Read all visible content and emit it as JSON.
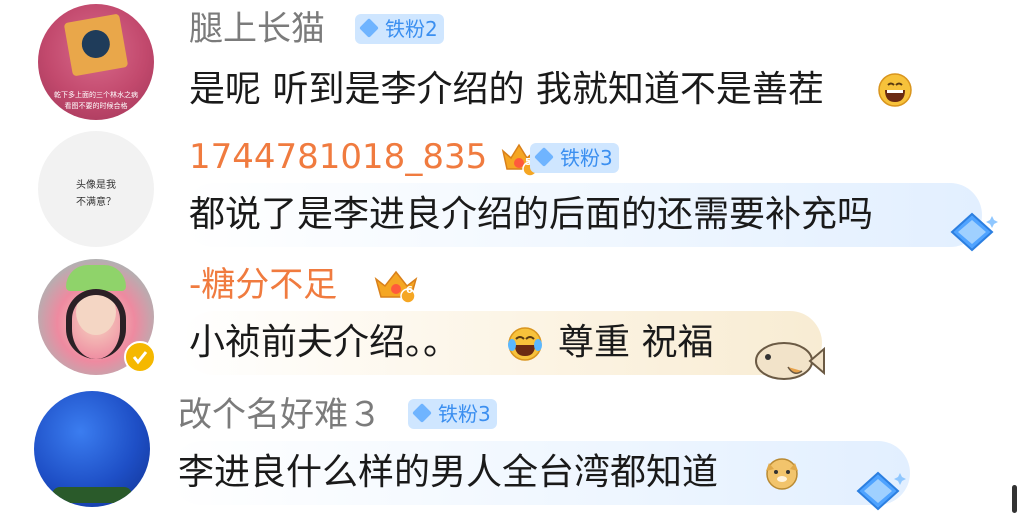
{
  "comments": [
    {
      "username": "腿上长猫",
      "badge": "铁粉2",
      "text": "是呢 听到是李介绍的 我就知道不是善茬",
      "emoji": "grin-emoji",
      "avatar_caption": "乾下多上面的三个林水之病",
      "avatar_caption2": "看图不要的时候合格"
    },
    {
      "username": "1744781018_835",
      "badge": "铁粉3",
      "text": "都说了是李进良介绍的后面的还需要补充吗",
      "avatar_text_line1": "头像是我",
      "avatar_text_line2": "不满意？",
      "crown_level": "5"
    },
    {
      "username": "-糖分不足",
      "text_part1": "小祯前夫介绍。。",
      "text_part2": "尊重 祝福",
      "emoji": "tears-of-joy-emoji",
      "crown_level": "6"
    },
    {
      "username": "改个名好难３",
      "badge": "铁粉3",
      "text": "李进良什么样的男人全台湾都知道",
      "emoji": "doge-emoji"
    }
  ],
  "colors": {
    "bubble_vip": "#eaf4ff",
    "bubble_yellow": "#fdf6e4",
    "badge_bg": "#cfe6ff",
    "badge_text": "#3b8ff0",
    "vip_name": "#f07b3f",
    "name": "#7b7b7b"
  }
}
